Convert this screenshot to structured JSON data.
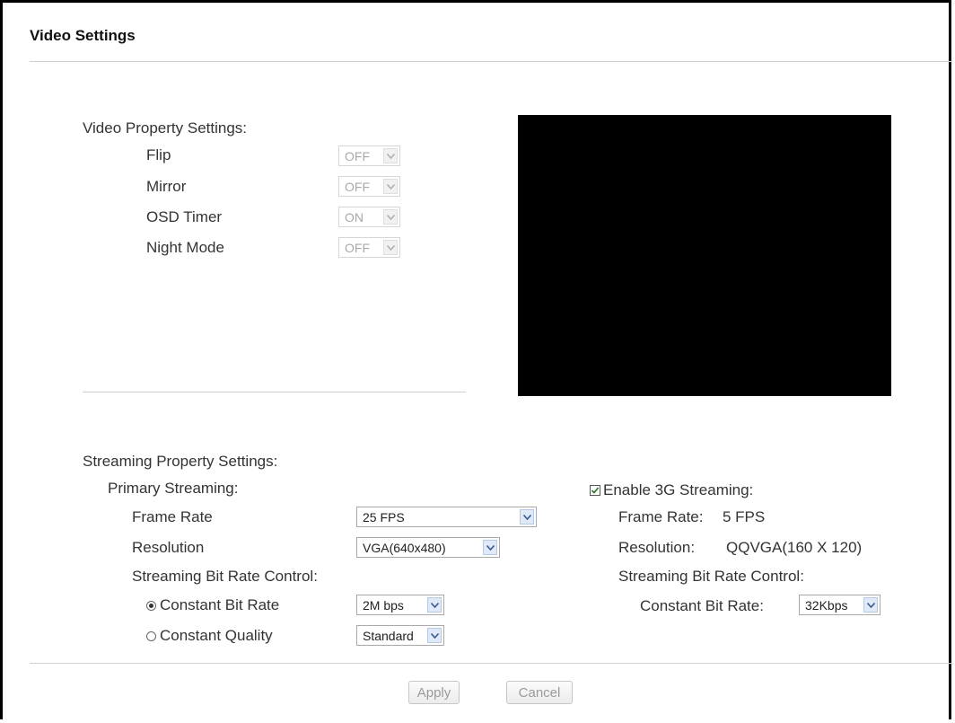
{
  "page": {
    "title": "Video Settings"
  },
  "video_property": {
    "heading": "Video Property Settings:",
    "items": [
      {
        "label": "Flip",
        "value": "OFF"
      },
      {
        "label": "Mirror",
        "value": "OFF"
      },
      {
        "label": "OSD Timer",
        "value": "ON"
      },
      {
        "label": "Night Mode",
        "value": "OFF"
      }
    ]
  },
  "streaming": {
    "heading": "Streaming Property Settings:",
    "primary": {
      "heading": "Primary Streaming:",
      "frame_rate_label": "Frame Rate",
      "frame_rate_value": "25 FPS",
      "resolution_label": "Resolution",
      "resolution_value": "VGA(640x480)",
      "bitrate_control_label": "Streaming Bit Rate Control:",
      "cbr_label": "Constant Bit Rate",
      "cbr_value": "2M bps",
      "cq_label": "Constant Quality",
      "cq_value": "Standard"
    },
    "g3": {
      "heading": "Enable 3G Streaming:",
      "enabled": true,
      "frame_rate_label": "Frame Rate:",
      "frame_rate_value": "5 FPS",
      "resolution_label": "Resolution:",
      "resolution_value": "QQVGA(160 X 120)",
      "bitrate_control_label": "Streaming Bit Rate Control:",
      "cbr_label": "Constant Bit Rate:",
      "cbr_value": "32Kbps"
    }
  },
  "buttons": {
    "apply": "Apply",
    "cancel": "Cancel"
  },
  "colors": {
    "video_preview": "#000000",
    "divider": "#cfcfcf",
    "disabled_text": "#a8a8a8"
  }
}
